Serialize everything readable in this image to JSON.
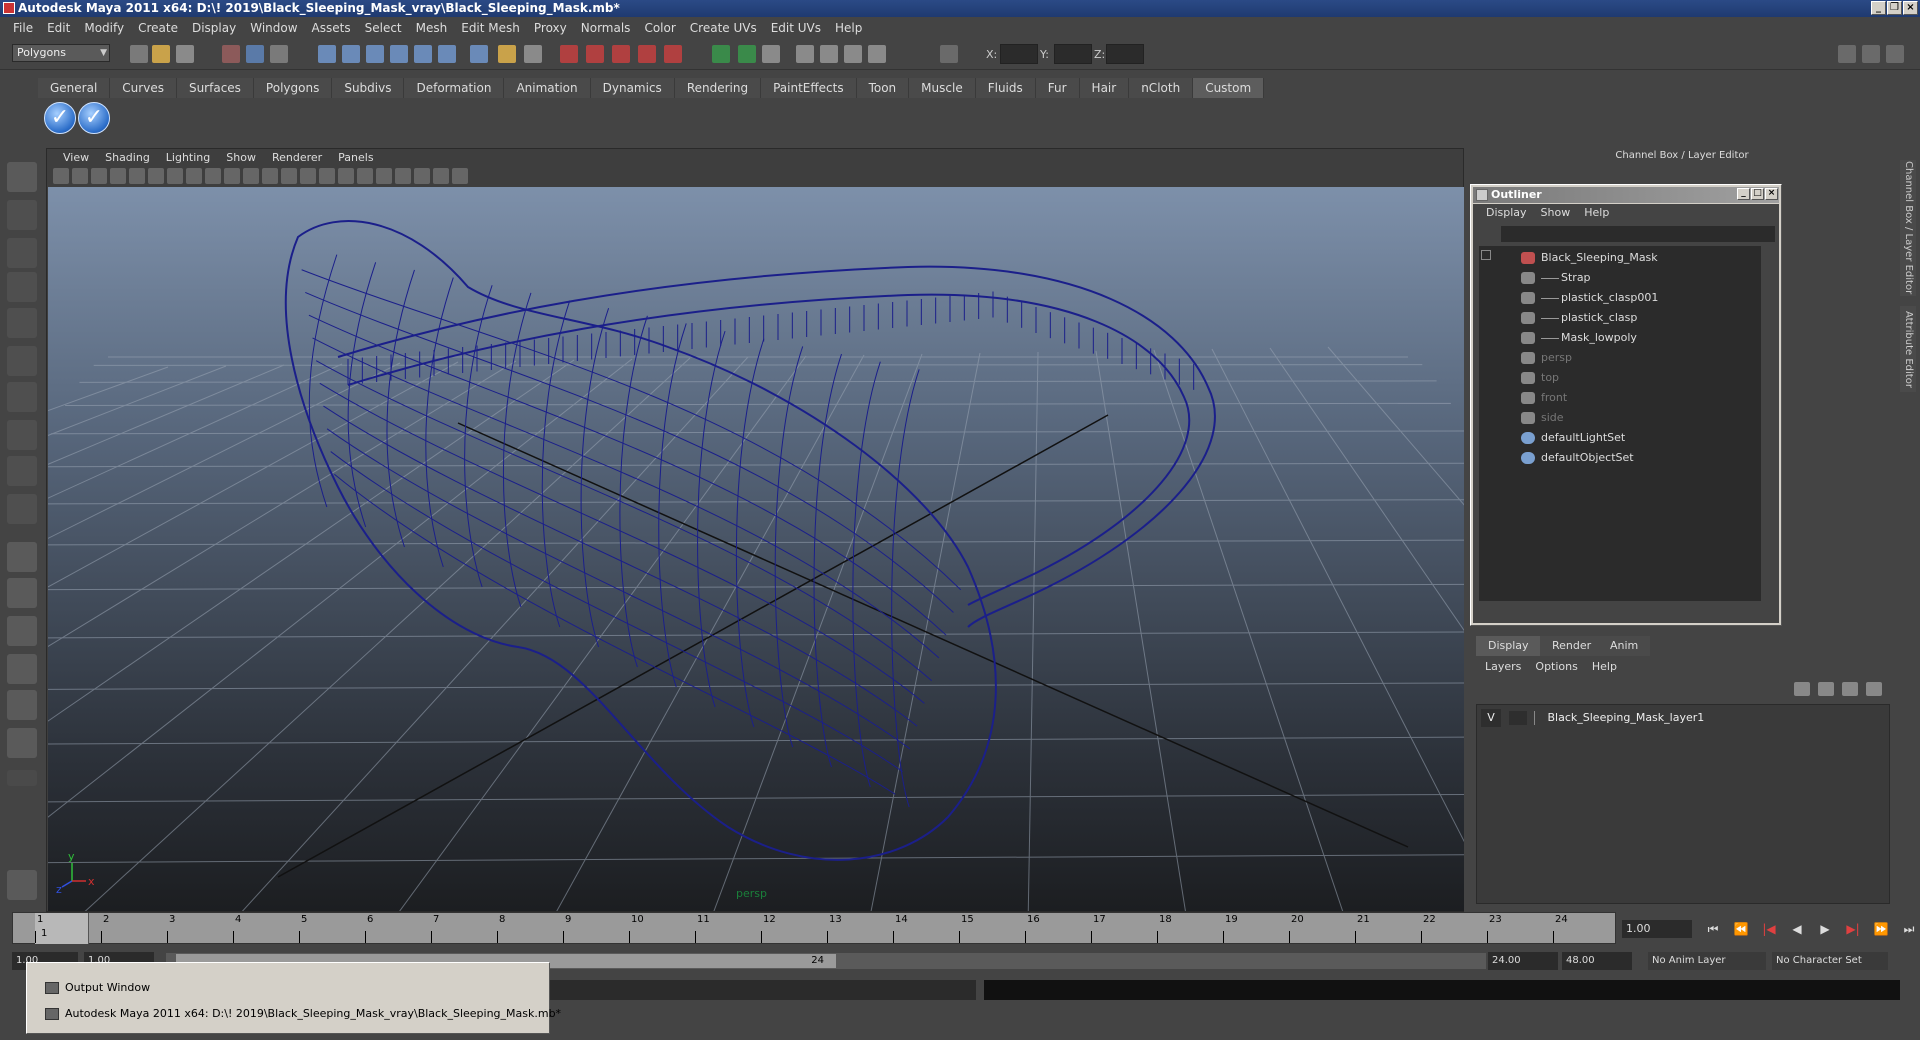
{
  "window": {
    "title": "Autodesk Maya 2011 x64: D:\\! 2019\\Black_Sleeping_Mask_vray\\Black_Sleeping_Mask.mb*"
  },
  "menubar": [
    "File",
    "Edit",
    "Modify",
    "Create",
    "Display",
    "Window",
    "Assets",
    "Select",
    "Mesh",
    "Edit Mesh",
    "Proxy",
    "Normals",
    "Color",
    "Create UVs",
    "Edit UVs",
    "Help"
  ],
  "status": {
    "mode": "Polygons",
    "x_label": "X:",
    "y_label": "Y:",
    "z_label": "Z:"
  },
  "shelf_tabs": [
    "General",
    "Curves",
    "Surfaces",
    "Polygons",
    "Subdivs",
    "Deformation",
    "Animation",
    "Dynamics",
    "Rendering",
    "PaintEffects",
    "Toon",
    "Muscle",
    "Fluids",
    "Fur",
    "Hair",
    "nCloth",
    "Custom"
  ],
  "shelf_active": "Custom",
  "viewport": {
    "menu": [
      "View",
      "Shading",
      "Lighting",
      "Show",
      "Renderer",
      "Panels"
    ],
    "camera_label": "persp",
    "axis_y": "y",
    "axis_x": "x",
    "axis_z": "z"
  },
  "channel_box_header": "Channel Box / Layer Editor",
  "side_tabs": [
    "Channel Box / Layer Editor",
    "Attribute Editor"
  ],
  "outliner": {
    "title": "Outliner",
    "menu": [
      "Display",
      "Show",
      "Help"
    ],
    "items": [
      {
        "label": "Black_Sleeping_Mask",
        "dim": false
      },
      {
        "label": "Strap",
        "dim": false
      },
      {
        "label": "plastick_clasp001",
        "dim": false
      },
      {
        "label": "plastick_clasp",
        "dim": false
      },
      {
        "label": "Mask_lowpoly",
        "dim": false
      },
      {
        "label": "persp",
        "dim": true
      },
      {
        "label": "top",
        "dim": true
      },
      {
        "label": "front",
        "dim": true
      },
      {
        "label": "side",
        "dim": true
      },
      {
        "label": "defaultLightSet",
        "dim": false
      },
      {
        "label": "defaultObjectSet",
        "dim": false
      }
    ]
  },
  "layer_editor": {
    "tabs": [
      "Display",
      "Render",
      "Anim"
    ],
    "menu": [
      "Layers",
      "Options",
      "Help"
    ],
    "visibility": "V",
    "layer_name": "Black_Sleeping_Mask_layer1"
  },
  "timeline": {
    "frames": [
      "1",
      "2",
      "3",
      "4",
      "5",
      "6",
      "7",
      "8",
      "9",
      "10",
      "11",
      "12",
      "13",
      "14",
      "15",
      "16",
      "17",
      "18",
      "19",
      "20",
      "21",
      "22",
      "23",
      "24"
    ],
    "current_frame_label": "1",
    "current_frame_field": "1.00"
  },
  "range": {
    "start": "1.00",
    "playback_start": "1.00",
    "slider_end_label": "24",
    "playback_end": "24.00",
    "end": "48.00",
    "anim_layer": "No Anim Layer",
    "character_set": "No Character Set"
  },
  "taskbar_popup": {
    "items": [
      "Output Window",
      "Autodesk Maya 2011 x64: D:\\! 2019\\Black_Sleeping_Mask_vray\\Black_Sleeping_Mask.mb*"
    ]
  },
  "colors": {
    "wireframe": "#1b1f8a",
    "titlebar": "#1f3a70"
  }
}
